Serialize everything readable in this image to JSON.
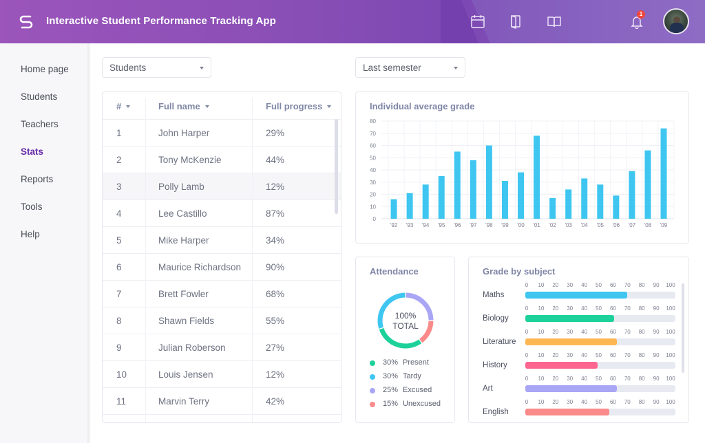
{
  "header": {
    "app_title": "Interactive Student Performance Tracking App",
    "logo_icon": "s-logo-icon",
    "icons": [
      "calendar-icon",
      "notebook-icon",
      "open-book-icon"
    ],
    "notification_count": "1",
    "brand_color": "#8a4fb6"
  },
  "sidebar": {
    "items": [
      {
        "label": "Home page",
        "active": false
      },
      {
        "label": "Students",
        "active": false
      },
      {
        "label": "Teachers",
        "active": false
      },
      {
        "label": "Stats",
        "active": true
      },
      {
        "label": "Reports",
        "active": false
      },
      {
        "label": "Tools",
        "active": false
      },
      {
        "label": "Help",
        "active": false
      }
    ],
    "active_color": "#6a2da8"
  },
  "filters": {
    "group_select": "Students",
    "period_select": "Last semester"
  },
  "students_table": {
    "columns": [
      "#",
      "Full name",
      "Full progress"
    ],
    "rows": [
      {
        "num": "1",
        "name": "John Harper",
        "progress": "29%"
      },
      {
        "num": "2",
        "name": "Tony McKenzie",
        "progress": "44%"
      },
      {
        "num": "3",
        "name": "Polly Lamb",
        "progress": "12%"
      },
      {
        "num": "4",
        "name": "Lee Castillo",
        "progress": "87%"
      },
      {
        "num": "5",
        "name": "Mike Harper",
        "progress": "34%"
      },
      {
        "num": "6",
        "name": "Maurice Richardson",
        "progress": "90%"
      },
      {
        "num": "7",
        "name": "Brett Fowler",
        "progress": "68%"
      },
      {
        "num": "8",
        "name": "Shawn Fields",
        "progress": "55%"
      },
      {
        "num": "9",
        "name": "Julian Roberson",
        "progress": "27%"
      },
      {
        "num": "10",
        "name": "Louis Jensen",
        "progress": "12%"
      },
      {
        "num": "11",
        "name": "Marvin Terry",
        "progress": "42%"
      }
    ],
    "highlighted_row": 2
  },
  "chart_data": [
    {
      "type": "bar",
      "title": "Individual average grade",
      "categories": [
        "'92",
        "'93",
        "'94",
        "'95",
        "'96",
        "'97",
        "'98",
        "'99",
        "'00",
        "'01",
        "'02",
        "'03",
        "'04",
        "'05",
        "'06",
        "'07",
        "'08",
        "'09"
      ],
      "values": [
        16,
        21,
        28,
        35,
        55,
        48,
        60,
        31,
        38,
        68,
        17,
        24,
        33,
        28,
        19,
        39,
        56,
        74
      ],
      "xlabel": "",
      "ylabel": "",
      "ylim": [
        0,
        80
      ],
      "yticks": [
        0,
        10,
        20,
        30,
        40,
        50,
        60,
        70,
        80
      ],
      "grid": true,
      "color": "#3ec6f1"
    },
    {
      "type": "pie",
      "title": "Attendance",
      "center_text": [
        "100%",
        "TOTAL"
      ],
      "slices": [
        {
          "label": "Excused",
          "value": 25,
          "pct": "25%",
          "color": "#a9a6f6"
        },
        {
          "label": "Unexcused",
          "value": 15,
          "pct": "15%",
          "color": "#fb8a8a"
        },
        {
          "label": "Present",
          "value": 30,
          "pct": "30%",
          "color": "#1dd19a"
        },
        {
          "label": "Tardy",
          "value": 30,
          "pct": "30%",
          "color": "#3ec6f1"
        }
      ],
      "legend": [
        {
          "label": "Present",
          "pct": "30%",
          "color": "#1dd19a"
        },
        {
          "label": "Tardy",
          "pct": "30%",
          "color": "#3ec6f1"
        },
        {
          "label": "Excused",
          "pct": "25%",
          "color": "#a9a6f6"
        },
        {
          "label": "Unexcused",
          "pct": "15%",
          "color": "#fb8a8a"
        }
      ]
    },
    {
      "type": "bar",
      "orientation": "horizontal",
      "title": "Grade by subject",
      "categories": [
        "Maths",
        "Biology",
        "Literature",
        "History",
        "Art",
        "English"
      ],
      "values": [
        68,
        59,
        61,
        48,
        61,
        56
      ],
      "colors": [
        "#3ec6f1",
        "#1dd19a",
        "#fdb651",
        "#fb6590",
        "#a9a6f6",
        "#fb8a8a"
      ],
      "xlim": [
        0,
        100
      ],
      "xticks": [
        0,
        10,
        20,
        30,
        40,
        50,
        60,
        70,
        80,
        90,
        100
      ]
    }
  ]
}
